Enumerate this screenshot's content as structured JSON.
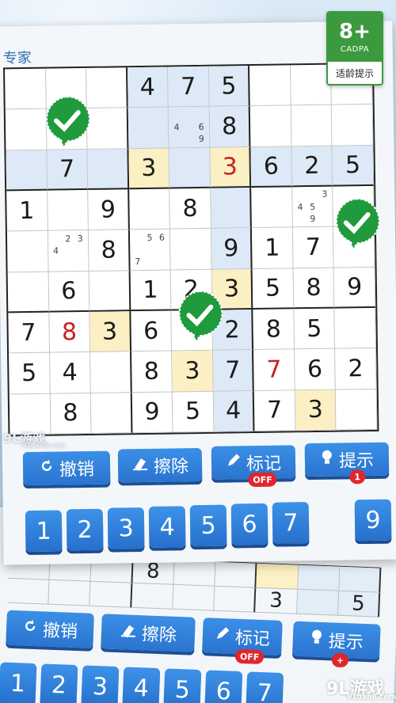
{
  "front": {
    "difficulty": "专家",
    "grid": [
      [
        {
          "v": ""
        },
        {
          "v": ""
        },
        {
          "v": ""
        },
        {
          "v": "4",
          "bg": "blue"
        },
        {
          "v": "7",
          "bg": "blue"
        },
        {
          "v": "5",
          "bg": "blue"
        },
        {
          "v": ""
        },
        {
          "v": ""
        },
        {
          "v": ""
        }
      ],
      [
        {
          "v": ""
        },
        {
          "v": ""
        },
        {
          "v": ""
        },
        {
          "v": "",
          "bg": "blue"
        },
        {
          "v": "",
          "bg": "blue",
          "notes": [
            "",
            "",
            "",
            "4",
            "",
            "6",
            "",
            "",
            "9"
          ]
        },
        {
          "v": "8",
          "bg": "blue"
        },
        {
          "v": ""
        },
        {
          "v": ""
        },
        {
          "v": ""
        }
      ],
      [
        {
          "v": "",
          "bg": "blue"
        },
        {
          "v": "7",
          "bg": "blue"
        },
        {
          "v": "",
          "bg": "blue"
        },
        {
          "v": "3",
          "bg": "yellow"
        },
        {
          "v": "",
          "bg": "blue"
        },
        {
          "v": "3",
          "bg": "yellow",
          "red": true
        },
        {
          "v": "6",
          "bg": "blue"
        },
        {
          "v": "2",
          "bg": "blue"
        },
        {
          "v": "5",
          "bg": "blue"
        }
      ],
      [
        {
          "v": "1"
        },
        {
          "v": ""
        },
        {
          "v": "9"
        },
        {
          "v": ""
        },
        {
          "v": "8"
        },
        {
          "v": "",
          "bg": "blue"
        },
        {
          "v": ""
        },
        {
          "v": "",
          "notes": [
            "",
            "",
            "3",
            "4",
            "5",
            "",
            "",
            "9",
            ""
          ]
        },
        {
          "v": ""
        }
      ],
      [
        {
          "v": ""
        },
        {
          "v": "",
          "notes": [
            "",
            "2",
            "3",
            "4",
            "",
            "",
            "",
            "",
            ""
          ]
        },
        {
          "v": "8"
        },
        {
          "v": "",
          "notes": [
            "",
            "5",
            "6",
            "",
            "",
            "",
            "7",
            "",
            ""
          ]
        },
        {
          "v": ""
        },
        {
          "v": "9",
          "bg": "blue"
        },
        {
          "v": "1"
        },
        {
          "v": "7"
        },
        {
          "v": ""
        }
      ],
      [
        {
          "v": ""
        },
        {
          "v": "6"
        },
        {
          "v": ""
        },
        {
          "v": "1"
        },
        {
          "v": "2"
        },
        {
          "v": "3",
          "bg": "yellow"
        },
        {
          "v": "5"
        },
        {
          "v": "8"
        },
        {
          "v": "9"
        }
      ],
      [
        {
          "v": "7"
        },
        {
          "v": "8",
          "red": true
        },
        {
          "v": "3",
          "bg": "yellow"
        },
        {
          "v": "6"
        },
        {
          "v": ""
        },
        {
          "v": "2",
          "bg": "blue"
        },
        {
          "v": "8"
        },
        {
          "v": "5"
        },
        {
          "v": ""
        }
      ],
      [
        {
          "v": "5"
        },
        {
          "v": "4"
        },
        {
          "v": ""
        },
        {
          "v": "8"
        },
        {
          "v": "3",
          "bg": "yellow"
        },
        {
          "v": "7",
          "bg": "blue"
        },
        {
          "v": "7",
          "red": true
        },
        {
          "v": "6"
        },
        {
          "v": "2"
        }
      ],
      [
        {
          "v": ""
        },
        {
          "v": "8"
        },
        {
          "v": ""
        },
        {
          "v": "9"
        },
        {
          "v": "5"
        },
        {
          "v": "4",
          "bg": "blue"
        },
        {
          "v": "7"
        },
        {
          "v": "3",
          "bg": "yellow"
        },
        {
          "v": ""
        }
      ]
    ],
    "buttons": {
      "undo": "撤销",
      "erase": "擦除",
      "mark": "标记",
      "mark_badge": "OFF",
      "hint": "提示",
      "hint_badge": "1"
    },
    "numpad": [
      "1",
      "2",
      "3",
      "4",
      "5",
      "6",
      "7",
      "",
      "9"
    ]
  },
  "back": {
    "row_values": [
      "",
      "",
      "",
      "8",
      "",
      "",
      "",
      "",
      ""
    ],
    "row2_values": [
      "",
      "",
      "",
      "",
      "",
      "",
      "3",
      "",
      "5"
    ],
    "buttons": {
      "undo": "撤销",
      "erase": "擦除",
      "mark": "标记",
      "mark_badge": "OFF",
      "hint": "提示",
      "hint_badge": "+"
    },
    "numpad": [
      "1",
      "2",
      "3",
      "4",
      "5",
      "6",
      "7"
    ]
  },
  "rating": {
    "age": "8+",
    "org": "CADPA",
    "label": "适龄提示"
  },
  "watermark": {
    "logo": "9L游戏",
    "url": "91danji.com",
    "logo_bottom": "9L游戏",
    "url_bottom": "91danji.com"
  },
  "colors": {
    "button_blue": "#2a74cf",
    "badge_red": "#e0262b",
    "check_green": "#1f9a3c",
    "cell_blue": "#dde9f6",
    "cell_yellow": "#fbf0c3",
    "error_red": "#c8201f"
  },
  "icons": {
    "undo": "undo-arrow-icon",
    "erase": "eraser-icon",
    "mark": "pencil-icon",
    "hint": "lightbulb-icon",
    "check": "checkmark-badge-icon"
  }
}
